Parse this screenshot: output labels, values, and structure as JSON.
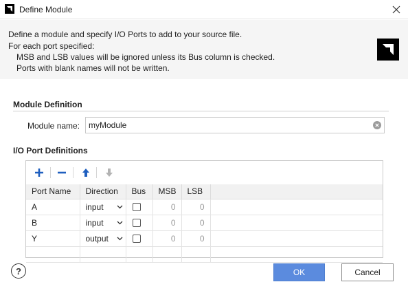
{
  "window": {
    "title": "Define Module"
  },
  "header": {
    "line1": "Define a module and specify I/O Ports to add to your source file.",
    "line2": "For each port specified:",
    "line3": "MSB and LSB values will be ignored unless its Bus column is checked.",
    "line4": "Ports with blank names will not be written."
  },
  "module_definition": {
    "section_title": "Module Definition",
    "name_label": "Module name:",
    "name_value": "myModule"
  },
  "ports": {
    "section_title": "I/O Port Definitions",
    "toolbar": [
      "add-icon",
      "remove-icon",
      "move-up-icon",
      "move-down-icon"
    ],
    "columns": [
      "Port Name",
      "Direction",
      "Bus",
      "MSB",
      "LSB"
    ],
    "rows": [
      {
        "name": "A",
        "direction": "input",
        "bus": false,
        "msb": "0",
        "lsb": "0"
      },
      {
        "name": "B",
        "direction": "input",
        "bus": false,
        "msb": "0",
        "lsb": "0"
      },
      {
        "name": "Y",
        "direction": "output",
        "bus": false,
        "msb": "0",
        "lsb": "0"
      }
    ]
  },
  "buttons": {
    "help": "?",
    "ok": "OK",
    "cancel": "Cancel"
  },
  "colors": {
    "ok_button": "#5b8bde",
    "header_bg": "#f5f5f5",
    "add_icon": "#1f5fbf"
  }
}
